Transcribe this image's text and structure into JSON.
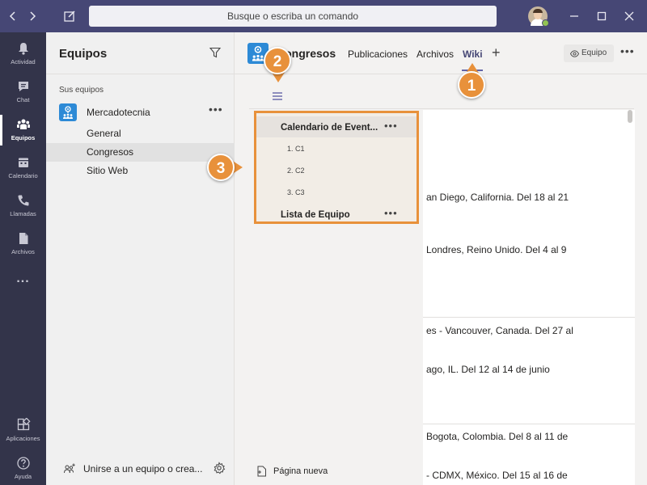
{
  "titlebar": {
    "back_icon": "chevron-left-icon",
    "forward_icon": "chevron-right-icon",
    "compose_icon": "compose-icon",
    "search_placeholder": "Busque o escriba un comando",
    "avatar_status_color": "#92c353",
    "minimize_icon": "minimize-icon",
    "maximize_icon": "maximize-icon",
    "close_icon": "close-icon"
  },
  "rail": {
    "items": [
      {
        "label": "Actividad",
        "icon": "bell-icon"
      },
      {
        "label": "Chat",
        "icon": "chat-icon"
      },
      {
        "label": "Equipos",
        "icon": "teams-icon",
        "active": true
      },
      {
        "label": "Calendario",
        "icon": "calendar-icon"
      },
      {
        "label": "Llamadas",
        "icon": "phone-icon"
      },
      {
        "label": "Archivos",
        "icon": "file-icon"
      },
      {
        "label": "...",
        "icon": "more-icon"
      }
    ],
    "bottom_items": [
      {
        "label": "Aplicaciones",
        "icon": "apps-icon"
      },
      {
        "label": "Ayuda",
        "icon": "help-icon"
      }
    ]
  },
  "panel": {
    "title": "Equipos",
    "section_label": "Sus equipos",
    "team_name": "Mercadotecnia",
    "team_more": "•••",
    "channels": [
      "General",
      "Congresos",
      "Sitio Web"
    ],
    "selected_channel": "Congresos",
    "join_text": "Unirse a un equipo o crea...",
    "join_icon": "join-team-icon",
    "settings_icon": "gear-icon"
  },
  "header": {
    "channel_name": "Congresos",
    "tabs": [
      "Publicaciones",
      "Archivos",
      "Wiki"
    ],
    "active_tab": "Wiki",
    "add_tab": "+",
    "team_button": "Equipo",
    "more": "•••"
  },
  "wiki": {
    "toc": [
      {
        "label": "Calendario de Event...",
        "more": "•••"
      },
      {
        "label": "1. C1"
      },
      {
        "label": "2. C2"
      },
      {
        "label": "3. C3"
      },
      {
        "label": "Lista de Equipo",
        "more": "•••"
      }
    ],
    "new_page": "Página nueva",
    "content_lines": [
      "an Diego, California.  Del 18 al 21",
      "Londres, Reino Unido.  Del 4 al 9",
      "es - Vancouver, Canada. Del 27 al",
      "ago, IL.  Del 12 al 14 de junio",
      "Bogota, Colombia. Del 8 al 11 de",
      " - CDMX, México. Del 15 al 16 de"
    ]
  },
  "callouts": [
    "1",
    "2",
    "3"
  ],
  "colors": {
    "titlebar": "#464775",
    "rail": "#33344a",
    "accent": "#6264a7",
    "callout": "#e8913b",
    "team_logo": "#2d8ad6"
  }
}
